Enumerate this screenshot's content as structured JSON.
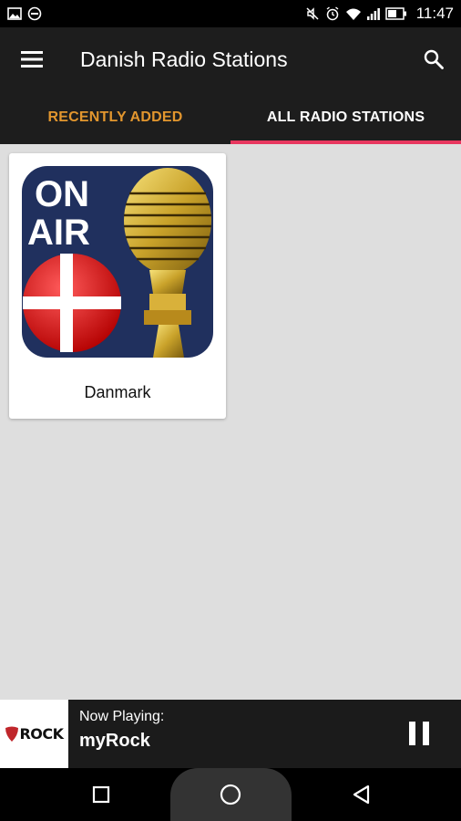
{
  "status_bar": {
    "time": "11:47",
    "left_icons": [
      "image-icon",
      "blocked-icon"
    ],
    "right_icons": [
      "mute-icon",
      "alarm-icon",
      "wifi-icon",
      "signal-icon",
      "battery-icon"
    ]
  },
  "app_bar": {
    "title": "Danish Radio Stations",
    "menu_icon": "hamburger-menu-icon",
    "search_icon": "search-icon"
  },
  "tabs": [
    {
      "label": "RECENTLY ADDED",
      "active": false,
      "color": "#e2962e"
    },
    {
      "label": "ALL RADIO STATIONS",
      "active": true,
      "color": "#ffffff"
    }
  ],
  "accent_color": "#e8375f",
  "stations": [
    {
      "name": "Danmark",
      "art": {
        "line1": "ON",
        "line2": "AIR"
      }
    }
  ],
  "player": {
    "logo_text": "ROCK",
    "label": "Now Playing:",
    "station": "myRock",
    "state_icon": "pause-icon"
  },
  "nav_bar": {
    "icons": [
      "recents-square-icon",
      "home-circle-icon",
      "back-triangle-icon"
    ]
  }
}
